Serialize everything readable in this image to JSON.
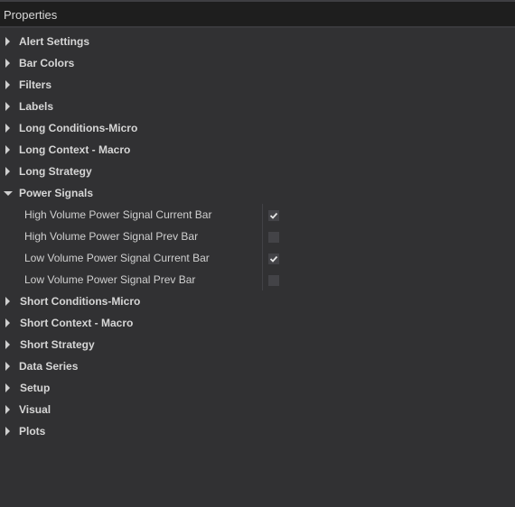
{
  "header": {
    "title": "Properties"
  },
  "categories_top": [
    {
      "label": "Alert Settings",
      "expanded": false
    },
    {
      "label": "Bar Colors",
      "expanded": false
    },
    {
      "label": "Filters",
      "expanded": false
    },
    {
      "label": "Labels",
      "expanded": false
    },
    {
      "label": "Long Conditions-Micro",
      "expanded": false
    },
    {
      "label": "Long Context - Macro",
      "expanded": false
    },
    {
      "label": "Long Strategy",
      "expanded": false
    }
  ],
  "power_signals": {
    "label": "Power Signals",
    "expanded": true,
    "properties": [
      {
        "label": "High Volume Power Signal Current Bar",
        "checked": true
      },
      {
        "label": "High Volume Power Signal Prev Bar",
        "checked": false
      },
      {
        "label": "Low Volume Power Signal Current Bar",
        "checked": true
      },
      {
        "label": "Low Volume Power Signal Prev Bar",
        "checked": false
      }
    ]
  },
  "categories_bottom": [
    {
      "label": "Short Conditions-Micro",
      "expanded": false
    },
    {
      "label": "Short Context - Macro",
      "expanded": false
    },
    {
      "label": "Short Strategy",
      "expanded": false
    },
    {
      "label": "Data Series",
      "expanded": false
    },
    {
      "label": "Setup",
      "expanded": false
    },
    {
      "label": "Visual",
      "expanded": false
    },
    {
      "label": "Plots",
      "expanded": false
    }
  ]
}
